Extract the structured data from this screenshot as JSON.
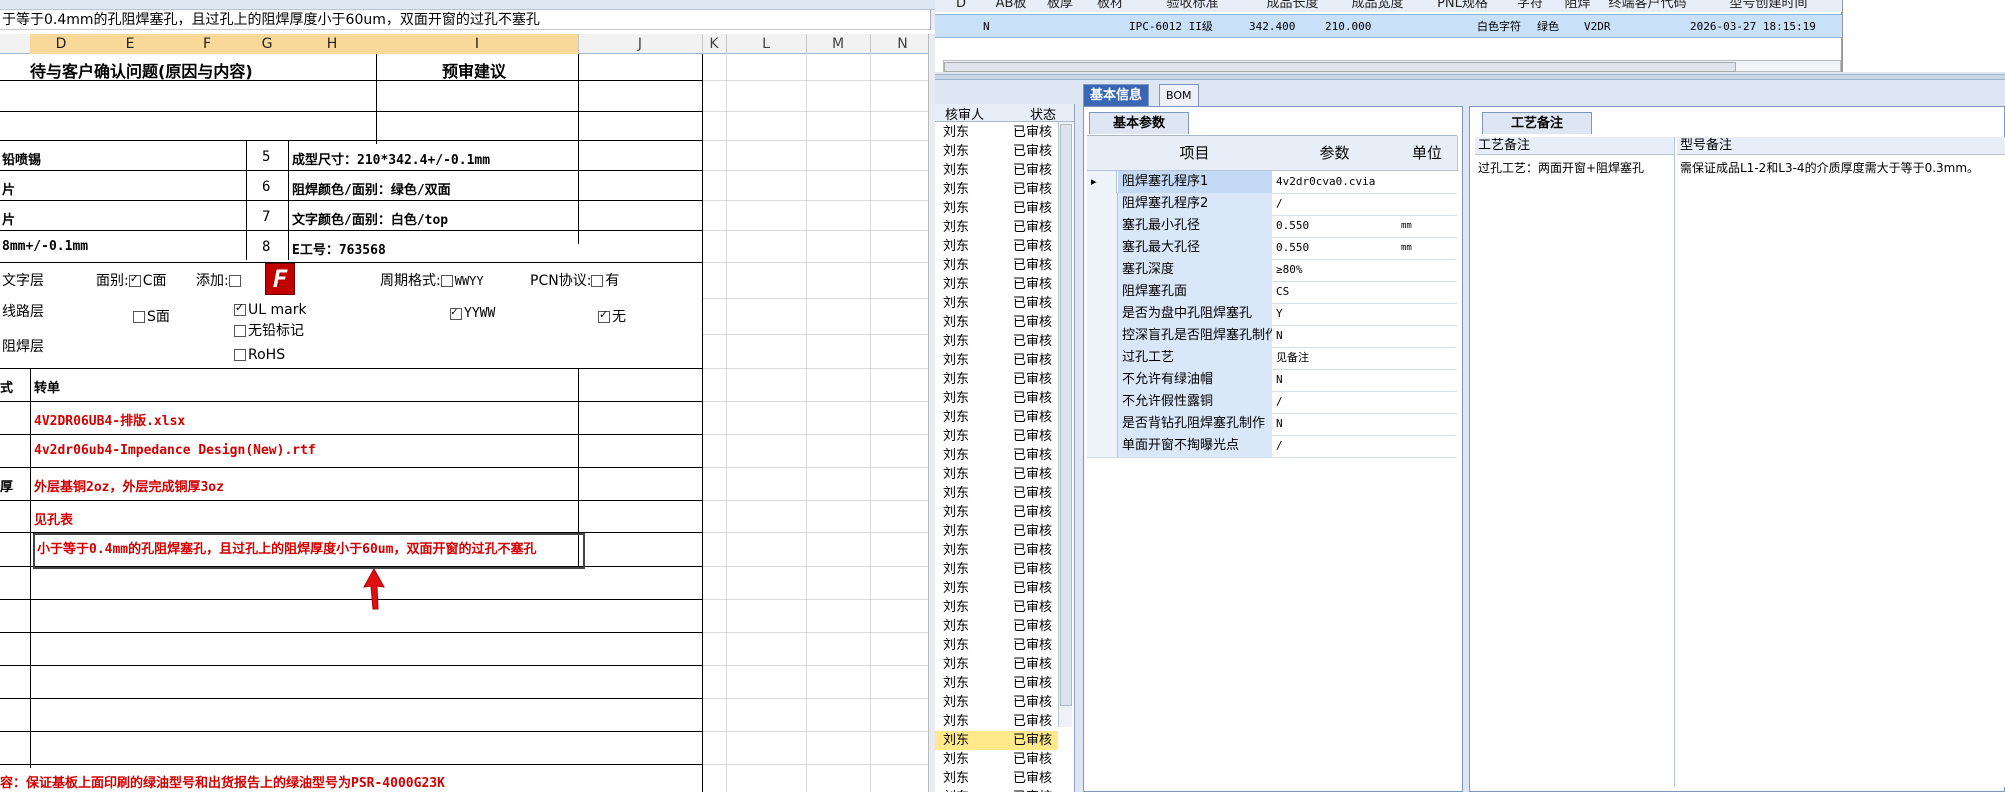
{
  "spreadsheet": {
    "formula_text": "于等于0.4mm的孔阻焊塞孔，且过孔上的阻焊厚度小于60um，双面开窗的过孔不塞孔",
    "columns": [
      "D",
      "E",
      "F",
      "G",
      "H",
      "I",
      "J",
      "K",
      "L",
      "M",
      "N"
    ],
    "header_left": "待与客户确认问题(原因与内容)",
    "header_right": "预审建议",
    "rows": [
      {
        "left": "铅喷锡",
        "num": "5",
        "desc": "成型尺寸：210*342.4+/-0.1mm"
      },
      {
        "left": "片",
        "num": "6",
        "desc": "阻焊颜色/面别：绿色/双面"
      },
      {
        "left": "片",
        "num": "7",
        "desc": "文字颜色/面别：白色/top"
      },
      {
        "left": "8mm+/-0.1mm",
        "num": "8",
        "desc": "E工号：763568"
      }
    ],
    "text_layer": {
      "label": "文字层",
      "face_label": "面别:",
      "c_face": "C面",
      "s_face": "S面",
      "add_label": "添加:",
      "logo_letter": "F",
      "cycle_label": "周期格式:",
      "wwyy": "WWYY",
      "yyww": "YYWW",
      "pcn_label": "PCN协议:",
      "pcn_yes": "有",
      "pcn_no": "无",
      "ul_mark": "UL mark",
      "no_lead": "无铅标记",
      "rohs": "RoHS"
    },
    "circuit_layer": "线路层",
    "mask_layer": "阻焊层",
    "format_label": "式",
    "transfer_label": "转单",
    "red_lines": [
      "4V2DR06UB4-排版.xlsx",
      "4v2dr06ub4-Impedance Design(New).rtf",
      "外层基铜2oz，外层完成铜厚3oz",
      "见孔表",
      "小于等于0.4mm的孔阻焊塞孔，且过孔上的阻焊厚度小于60um，双面开窗的过孔不塞孔"
    ],
    "thick_label": "厚",
    "footer_text": "容：保证基板上面印刷的绿油型号和出货报告上的绿油型号为PSR-4000G23K"
  },
  "top_grid": {
    "headers": [
      "D",
      "AB板",
      "板厚",
      "板材",
      "验收标准",
      "成品长度",
      "成品宽度",
      "PNL规格",
      "字符",
      "阻焊",
      "终端客户代码",
      "型号创建时间"
    ],
    "row": {
      "flag": "N",
      "standard": "IPC-6012 II级",
      "length": "342.400",
      "width": "210.000",
      "char": "白色字符",
      "mask": "绿色",
      "code": "V2DR",
      "created": "2026-03-27 18:15:19"
    }
  },
  "reviewer_panel": {
    "col_reviewer": "核审人",
    "col_status": "状态",
    "name": "刘东",
    "status": "已审核",
    "row_count": 36,
    "selected_index": 32
  },
  "tabs": {
    "basic_info": "基本信息",
    "bom": "BOM",
    "basic_params": "基本参数",
    "process_notes": "工艺备注"
  },
  "params_table": {
    "headers": [
      "项目",
      "参数",
      "单位"
    ],
    "rows": [
      {
        "item": "阻焊塞孔程序1",
        "param": "4v2dr0cva0.cvia",
        "unit": ""
      },
      {
        "item": "阻焊塞孔程序2",
        "param": "/",
        "unit": ""
      },
      {
        "item": "塞孔最小孔径",
        "param": "0.550",
        "unit": "mm"
      },
      {
        "item": "塞孔最大孔径",
        "param": "0.550",
        "unit": "mm"
      },
      {
        "item": "塞孔深度",
        "param": "≥80%",
        "unit": ""
      },
      {
        "item": "阻焊塞孔面",
        "param": "CS",
        "unit": ""
      },
      {
        "item": "是否为盘中孔阻焊塞孔",
        "param": "Y",
        "unit": ""
      },
      {
        "item": "控深盲孔是否阻焊塞孔制作",
        "param": "N",
        "unit": ""
      },
      {
        "item": "过孔工艺",
        "param": "见备注",
        "unit": ""
      },
      {
        "item": "不允许有绿油帽",
        "param": "N",
        "unit": ""
      },
      {
        "item": "不允许假性露铜",
        "param": "/",
        "unit": ""
      },
      {
        "item": "是否背钻孔阻焊塞孔制作",
        "param": "N",
        "unit": ""
      },
      {
        "item": "单面开窗不掏曝光点",
        "param": "/",
        "unit": ""
      }
    ]
  },
  "process_panel": {
    "col1_header": "工艺备注",
    "col1_value": "过孔工艺：两面开窗+阻焊塞孔",
    "col2_header": "型号备注",
    "col2_value": "需保证成品L1-2和L3-4的介质厚度需大于等于0.3mm。"
  },
  "colors": {
    "accent_tab": "#3a67b3",
    "selected_row": "#c8e0f8",
    "highlight_reviewer": "#ffe98a",
    "red_text": "#d40000"
  }
}
